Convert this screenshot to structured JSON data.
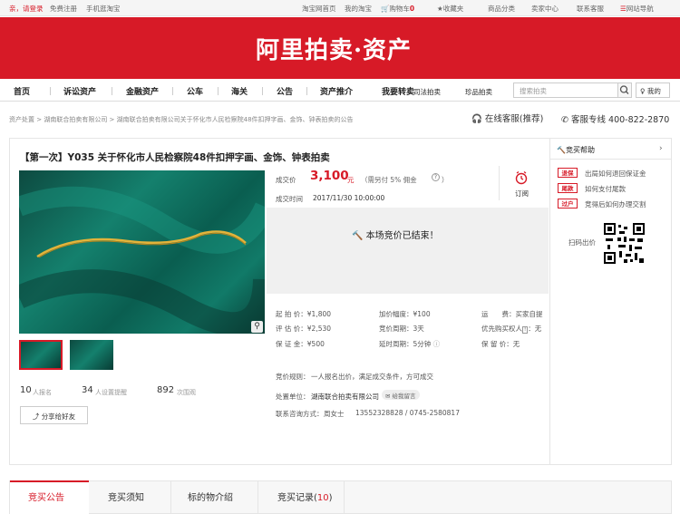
{
  "topbar": {
    "greeting": "亲，请登录",
    "register": "免费注册",
    "mobile": "手机逛淘宝",
    "home": "淘宝网首页",
    "my_taobao": "我的淘宝",
    "cart": "购物车",
    "cart_count": "0",
    "favorites": "收藏夹",
    "categories": "商品分类",
    "seller": "卖家中心",
    "service": "联系客服",
    "sitemap": "网站导航"
  },
  "banner": {
    "logo": "阿里拍卖·资产"
  },
  "nav": {
    "items": [
      "首页",
      "诉讼资产",
      "金融资产",
      "公车",
      "海关",
      "公告",
      "资产推介",
      "我要转卖",
      "司法拍卖",
      "珍品拍卖"
    ],
    "search_placeholder": "搜索拍卖",
    "mine": "我的"
  },
  "breadcrumb": {
    "text": "资产处置 > 湖南联合拍卖有限公司 > 湖南联合拍卖有限公司关于怀化市人民检察院48件扣押字画、金饰、钟表拍卖的公告",
    "online_service": "在线客服(推荐)",
    "hotline": "客服专线 400-822-2870"
  },
  "item": {
    "title": "【第一次】Y035 关于怀化市人民检察院48件扣押字画、金饰、钟表拍卖",
    "price_label": "成交价",
    "price": "3,100",
    "price_unit": "元",
    "commission": "（需另付 5% 佣金",
    "time_label": "成交时间",
    "time": "2017/11/30 10:00:00",
    "subscribe": "订阅",
    "ended_text": "本场竞价已结束！",
    "details": [
      {
        "label": "起 拍 价：",
        "value": "¥1,800"
      },
      {
        "label": "加价幅度：",
        "value": "¥100"
      },
      {
        "label": "运　　费：",
        "value": "买家自提"
      },
      {
        "label": "评 估 价：",
        "value": "¥2,530"
      },
      {
        "label": "竞价周期：",
        "value": "3天"
      },
      {
        "label": "优先购买权人",
        "value": "无"
      },
      {
        "label": "保 证 金：",
        "value": "¥500"
      },
      {
        "label": "延时周期：",
        "value": "5分钟"
      },
      {
        "label": "保 留 价：",
        "value": "无"
      }
    ],
    "rule_label": "竞价规则：",
    "rule": "一人报名出价，满足成交条件，方可成交",
    "org_label": "处置单位：",
    "org": "湖南联合拍卖有限公司",
    "org_msg": "给我留言",
    "contact_label": "联系咨询方式：",
    "contact_name": "周女士",
    "contact_phone": "13552328828 / 0745-2580817"
  },
  "stats": {
    "signup_count": "10",
    "signup_label": "人报名",
    "remind_count": "34",
    "remind_label": "人设置提醒",
    "view_count": "892",
    "view_label": "次围观",
    "share": "分享给好友"
  },
  "help": {
    "title": "竞买帮助",
    "rows": [
      {
        "tag": "退保",
        "text": "出局如何退回保证金"
      },
      {
        "tag": "尾款",
        "text": "如何支付尾款"
      },
      {
        "tag": "过户",
        "text": "竞得后如何办理交割"
      }
    ],
    "qr_label": "扫码出价"
  },
  "tabs": {
    "items": [
      "竞买公告",
      "竞买须知",
      "标的物介绍",
      "竞买记录"
    ],
    "record_count": "10"
  },
  "colors": {
    "brand": "#d71a27",
    "price": "#d71a27"
  }
}
